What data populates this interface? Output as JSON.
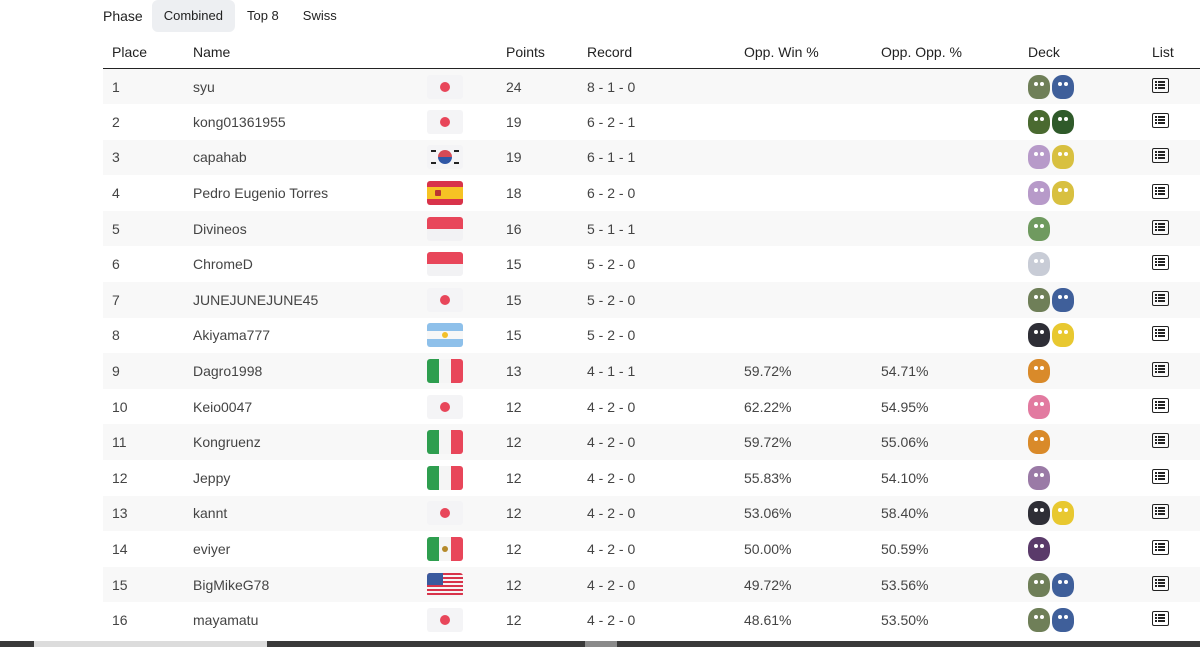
{
  "phase": {
    "label": "Phase",
    "tabs": [
      {
        "label": "Combined",
        "active": true
      },
      {
        "label": "Top 8",
        "active": false
      },
      {
        "label": "Swiss",
        "active": false
      }
    ]
  },
  "columns": {
    "place": "Place",
    "name": "Name",
    "points": "Points",
    "record": "Record",
    "opp_win": "Opp. Win %",
    "opp_opp": "Opp. Opp. %",
    "deck": "Deck",
    "list": "List"
  },
  "rows": [
    {
      "place": "1",
      "name": "syu",
      "flag": "jp",
      "points": "24",
      "record": "8 - 1 - 0",
      "opp_win": "",
      "opp_opp": "",
      "deck_colors": [
        "#6f7f58",
        "#3f5f9a"
      ]
    },
    {
      "place": "2",
      "name": "kong01361955",
      "flag": "jp",
      "points": "19",
      "record": "6 - 2 - 1",
      "opp_win": "",
      "opp_opp": "",
      "deck_colors": [
        "#4a6a30",
        "#2f5a2a"
      ]
    },
    {
      "place": "3",
      "name": "capahab",
      "flag": "kr",
      "points": "19",
      "record": "6 - 1 - 1",
      "opp_win": "",
      "opp_opp": "",
      "deck_colors": [
        "#b79ac9",
        "#d8c040"
      ]
    },
    {
      "place": "4",
      "name": "Pedro Eugenio Torres",
      "flag": "es",
      "points": "18",
      "record": "6 - 2 - 0",
      "opp_win": "",
      "opp_opp": "",
      "deck_colors": [
        "#b79ac9",
        "#d8c040"
      ]
    },
    {
      "place": "5",
      "name": "Divineos",
      "flag": "id",
      "points": "16",
      "record": "5 - 1 - 1",
      "opp_win": "",
      "opp_opp": "",
      "deck_colors": [
        "#6f9a5f"
      ]
    },
    {
      "place": "6",
      "name": "ChromeD",
      "flag": "id",
      "points": "15",
      "record": "5 - 2 - 0",
      "opp_win": "",
      "opp_opp": "",
      "deck_colors": [
        "#c8ccd6"
      ]
    },
    {
      "place": "7",
      "name": "JUNEJUNEJUNE45",
      "flag": "jp",
      "points": "15",
      "record": "5 - 2 - 0",
      "opp_win": "",
      "opp_opp": "",
      "deck_colors": [
        "#6f7f58",
        "#3f5f9a"
      ]
    },
    {
      "place": "8",
      "name": "Akiyama777",
      "flag": "ar",
      "points": "15",
      "record": "5 - 2 - 0",
      "opp_win": "",
      "opp_opp": "",
      "deck_colors": [
        "#2e2e36",
        "#e8c830"
      ]
    },
    {
      "place": "9",
      "name": "Dagro1998",
      "flag": "it",
      "points": "13",
      "record": "4 - 1 - 1",
      "opp_win": "59.72%",
      "opp_opp": "54.71%",
      "deck_colors": [
        "#d98a2a"
      ]
    },
    {
      "place": "10",
      "name": "Keio0047",
      "flag": "jp",
      "points": "12",
      "record": "4 - 2 - 0",
      "opp_win": "62.22%",
      "opp_opp": "54.95%",
      "deck_colors": [
        "#e27aa0"
      ]
    },
    {
      "place": "11",
      "name": "Kongruenz",
      "flag": "it",
      "points": "12",
      "record": "4 - 2 - 0",
      "opp_win": "59.72%",
      "opp_opp": "55.06%",
      "deck_colors": [
        "#d98a2a"
      ]
    },
    {
      "place": "12",
      "name": "Jeppy",
      "flag": "it",
      "points": "12",
      "record": "4 - 2 - 0",
      "opp_win": "55.83%",
      "opp_opp": "54.10%",
      "deck_colors": [
        "#9a7aa6"
      ]
    },
    {
      "place": "13",
      "name": "kannt",
      "flag": "jp",
      "points": "12",
      "record": "4 - 2 - 0",
      "opp_win": "53.06%",
      "opp_opp": "58.40%",
      "deck_colors": [
        "#2e2e36",
        "#e8c830"
      ]
    },
    {
      "place": "14",
      "name": "eviyer",
      "flag": "mx",
      "points": "12",
      "record": "4 - 2 - 0",
      "opp_win": "50.00%",
      "opp_opp": "50.59%",
      "deck_colors": [
        "#5a3a6a"
      ]
    },
    {
      "place": "15",
      "name": "BigMikeG78",
      "flag": "us",
      "points": "12",
      "record": "4 - 2 - 0",
      "opp_win": "49.72%",
      "opp_opp": "53.56%",
      "deck_colors": [
        "#6f7f58",
        "#3f5f9a"
      ]
    },
    {
      "place": "16",
      "name": "mayamatu",
      "flag": "jp",
      "points": "12",
      "record": "4 - 2 - 0",
      "opp_win": "48.61%",
      "opp_opp": "53.50%",
      "deck_colors": [
        "#6f7f58",
        "#3f5f9a"
      ]
    }
  ]
}
